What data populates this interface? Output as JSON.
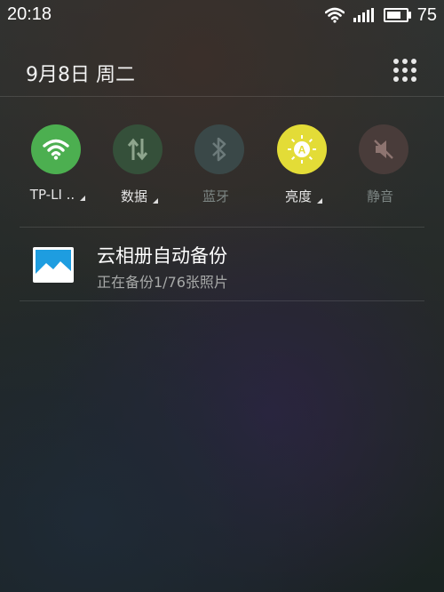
{
  "status_bar": {
    "time": "20:18",
    "battery_pct": "75",
    "battery_level": 0.75,
    "icons": [
      "wifi-icon",
      "signal-icon",
      "battery-icon"
    ]
  },
  "header": {
    "date": "9月8日  周二",
    "menu_icon": "grid-icon"
  },
  "toggles": [
    {
      "label": "TP-LI ..",
      "icon": "wifi-icon",
      "active": true,
      "color": "#4caf50",
      "has_caret": true
    },
    {
      "label": "数据",
      "icon": "data-arrows-icon",
      "active": true,
      "color": "#35503a",
      "has_caret": true
    },
    {
      "label": "蓝牙",
      "icon": "bluetooth-icon",
      "active": false,
      "color": "#3a4848",
      "has_caret": false
    },
    {
      "label": "亮度",
      "icon": "brightness-auto-icon",
      "active": true,
      "color": "#e3dc37",
      "has_caret": true
    },
    {
      "label": "静音",
      "icon": "mute-icon",
      "active": false,
      "color": "#493c3a",
      "has_caret": false
    }
  ],
  "notification": {
    "title": "云相册自动备份",
    "subtitle": "正在备份1/76张照片",
    "icon": "photo-icon",
    "icon_color": "#1e9de0"
  }
}
